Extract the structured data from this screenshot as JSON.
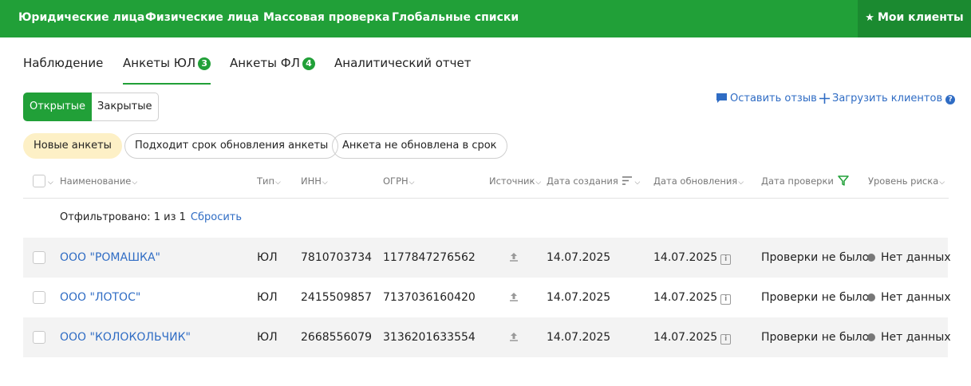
{
  "topnav": {
    "items": [
      "Юридические лица",
      "Физические лица",
      "Массовая проверка",
      "Глобальные списки"
    ],
    "my_clients": "Мои клиенты"
  },
  "tabs": [
    {
      "label": "Наблюдение",
      "badge": ""
    },
    {
      "label": "Анкеты ЮЛ",
      "badge": "3"
    },
    {
      "label": "Анкеты ФЛ",
      "badge": "4"
    },
    {
      "label": "Аналитический отчет",
      "badge": ""
    }
  ],
  "segment": {
    "open": "Открытые",
    "closed": "Закрытые"
  },
  "actions": {
    "feedback": "Оставить отзыв",
    "upload": "Загрузить клиентов",
    "help": "?"
  },
  "chips": [
    "Новые анкеты",
    "Подходит срок обновления анкеты",
    "Анкета не обновлена в срок"
  ],
  "table": {
    "headers": {
      "name": "Наименование",
      "type": "Тип",
      "inn": "ИНН",
      "ogrn": "ОГРН",
      "source": "Источник",
      "created": "Дата создания",
      "updated": "Дата обновления",
      "check_date": "Дата проверки",
      "risk": "Уровень риска"
    },
    "filter_text": "Отфильтровано: 1 из 1",
    "reset": "Сбросить",
    "rows": [
      {
        "name": "ООО \"РОМАШКА\"",
        "type": "ЮЛ",
        "inn": "7810703734",
        "ogrn": "1177847276562",
        "created": "14.07.2025",
        "updated": "14.07.2025",
        "check": "Проверки не было",
        "risk": "Нет данных"
      },
      {
        "name": "ООО \"ЛОТОС\"",
        "type": "ЮЛ",
        "inn": "2415509857",
        "ogrn": "7137036160420",
        "created": "14.07.2025",
        "updated": "14.07.2025",
        "check": "Проверки не было",
        "risk": "Нет данных"
      },
      {
        "name": "ООО \"КОЛОКОЛЬЧИК\"",
        "type": "ЮЛ",
        "inn": "2668556079",
        "ogrn": "3136201633554",
        "created": "14.07.2025",
        "updated": "14.07.2025",
        "check": "Проверки не было",
        "risk": "Нет данных"
      }
    ]
  },
  "colors": {
    "brand": "#21a038",
    "link": "#2f6cc4",
    "highlight": "#fdf0c6"
  }
}
